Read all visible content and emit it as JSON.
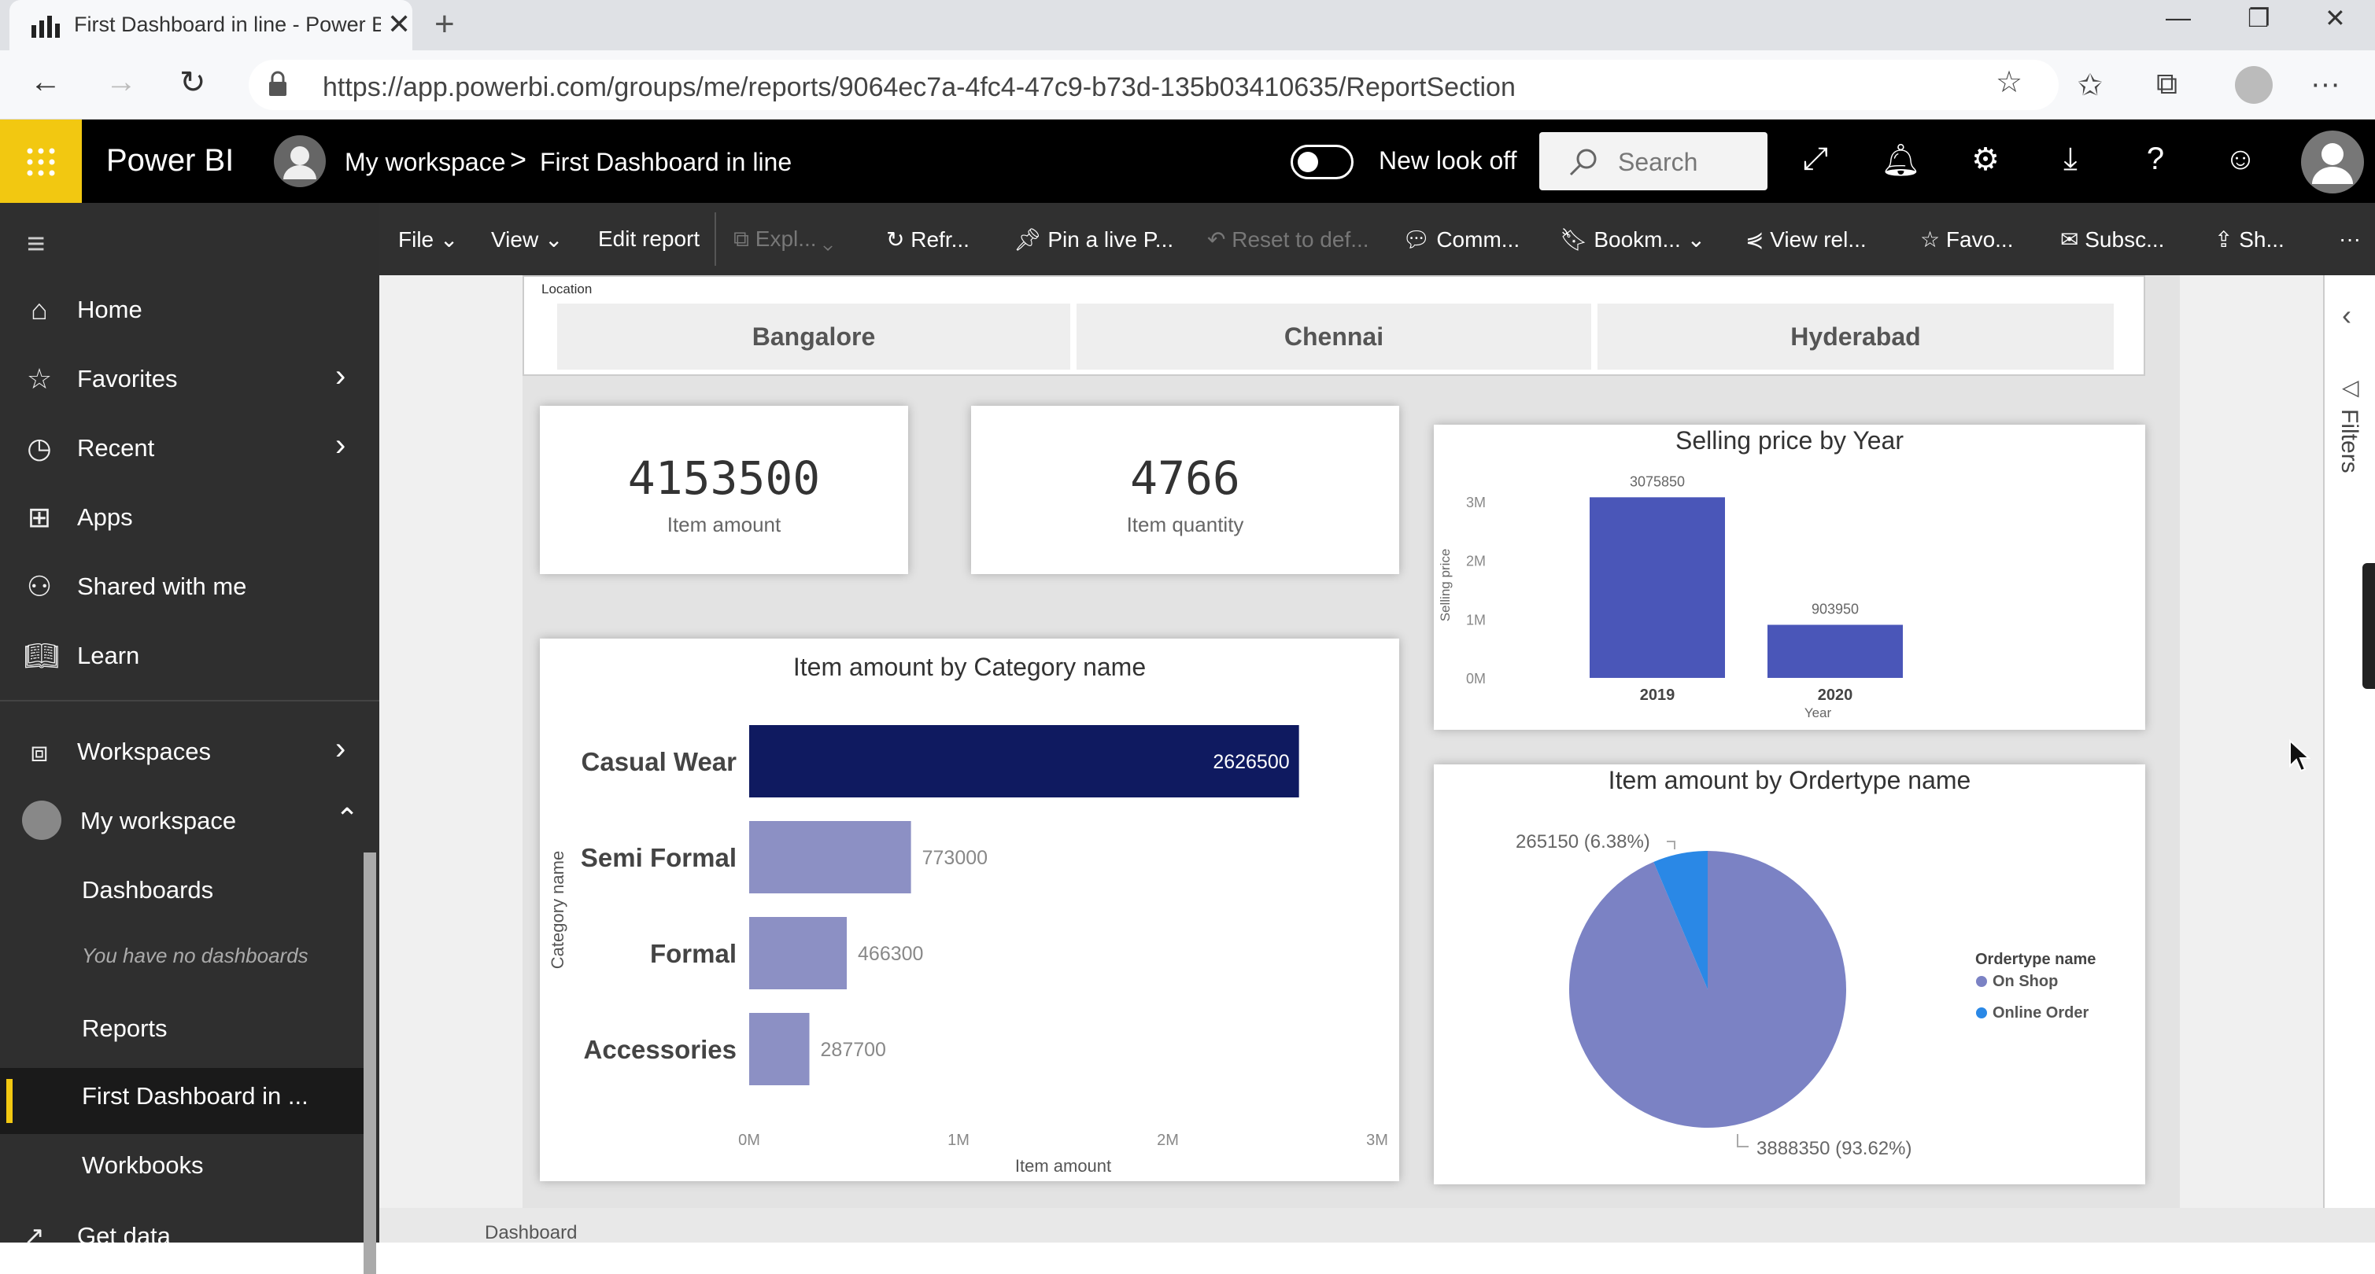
{
  "browser": {
    "tab_title": "First Dashboard in line - Power B",
    "url": "https://app.powerbi.com/groups/me/reports/9064ec7a-4fc4-47c9-b73d-135b03410635/ReportSection"
  },
  "header": {
    "brand": "Power BI",
    "breadcrumb_workspace": "My workspace",
    "breadcrumb_separator": ">",
    "breadcrumb_report": "First Dashboard in line",
    "toggle_label": "New look off",
    "search_placeholder": "Search"
  },
  "nav": {
    "items": [
      {
        "label": "Home"
      },
      {
        "label": "Favorites"
      },
      {
        "label": "Recent"
      },
      {
        "label": "Apps"
      },
      {
        "label": "Shared with me"
      },
      {
        "label": "Learn"
      },
      {
        "label": "Workspaces"
      },
      {
        "label": "My workspace"
      }
    ],
    "sub": {
      "dashboards": "Dashboards",
      "no_dashboards": "You have no dashboards",
      "reports": "Reports",
      "selected_report": "First Dashboard in ...",
      "workbooks": "Workbooks",
      "get_data": "Get data"
    }
  },
  "commands": {
    "file": "File",
    "view": "View",
    "edit": "Edit report",
    "explore": "Expl...",
    "refresh": "Refr...",
    "pin": "Pin a live P...",
    "reset": "Reset to def...",
    "comments": "Comm...",
    "bookmarks": "Bookm...",
    "view_related": "View rel...",
    "favorite": "Favo...",
    "subscribe": "Subsc...",
    "share": "Sh...",
    "more": "···"
  },
  "slicer": {
    "label": "Location",
    "options": [
      "Bangalore",
      "Chennai",
      "Hyderabad"
    ]
  },
  "kpis": [
    {
      "value": "4153500",
      "label": "Item amount"
    },
    {
      "value": "4766",
      "label": "Item quantity"
    }
  ],
  "right_pane": {
    "filters": "Filters"
  },
  "bottom": {
    "tab": "Dashboard"
  },
  "chart_data": [
    {
      "type": "bar",
      "title": "Item amount by Category name",
      "orientation": "horizontal",
      "categories": [
        "Casual Wear",
        "Semi Formal",
        "Formal",
        "Accessories"
      ],
      "values": [
        2626500,
        773000,
        466300,
        287700
      ],
      "value_labels": [
        "2626500",
        "773000",
        "466300",
        "287700"
      ],
      "xlabel": "Item amount",
      "ylabel": "Category name",
      "xlim": [
        0,
        3000000
      ],
      "xticks": [
        "0M",
        "1M",
        "2M",
        "3M"
      ],
      "colors": {
        "highlight": "#0f1a60",
        "normal": "#8c90c4"
      }
    },
    {
      "type": "bar",
      "title": "Selling price by Year",
      "categories": [
        "2019",
        "2020"
      ],
      "values": [
        3075850,
        903950
      ],
      "value_labels": [
        "3075850",
        "903950"
      ],
      "xlabel": "Year",
      "ylabel": "Selling price",
      "ylim": [
        0,
        3000000
      ],
      "yticks": [
        "0M",
        "1M",
        "2M",
        "3M"
      ],
      "colors": {
        "bar": "#4a56b8"
      }
    },
    {
      "type": "pie",
      "title": "Item amount by Ordertype name",
      "legend_title": "Ordertype name",
      "legend_position": "right",
      "slices": [
        {
          "name": "On Shop",
          "value": 3888350,
          "label": "3888350 (93.62%)",
          "color": "#7b82c4"
        },
        {
          "name": "Online Order",
          "value": 265150,
          "label": "265150 (6.38%)",
          "color": "#2a88e6"
        }
      ]
    }
  ]
}
